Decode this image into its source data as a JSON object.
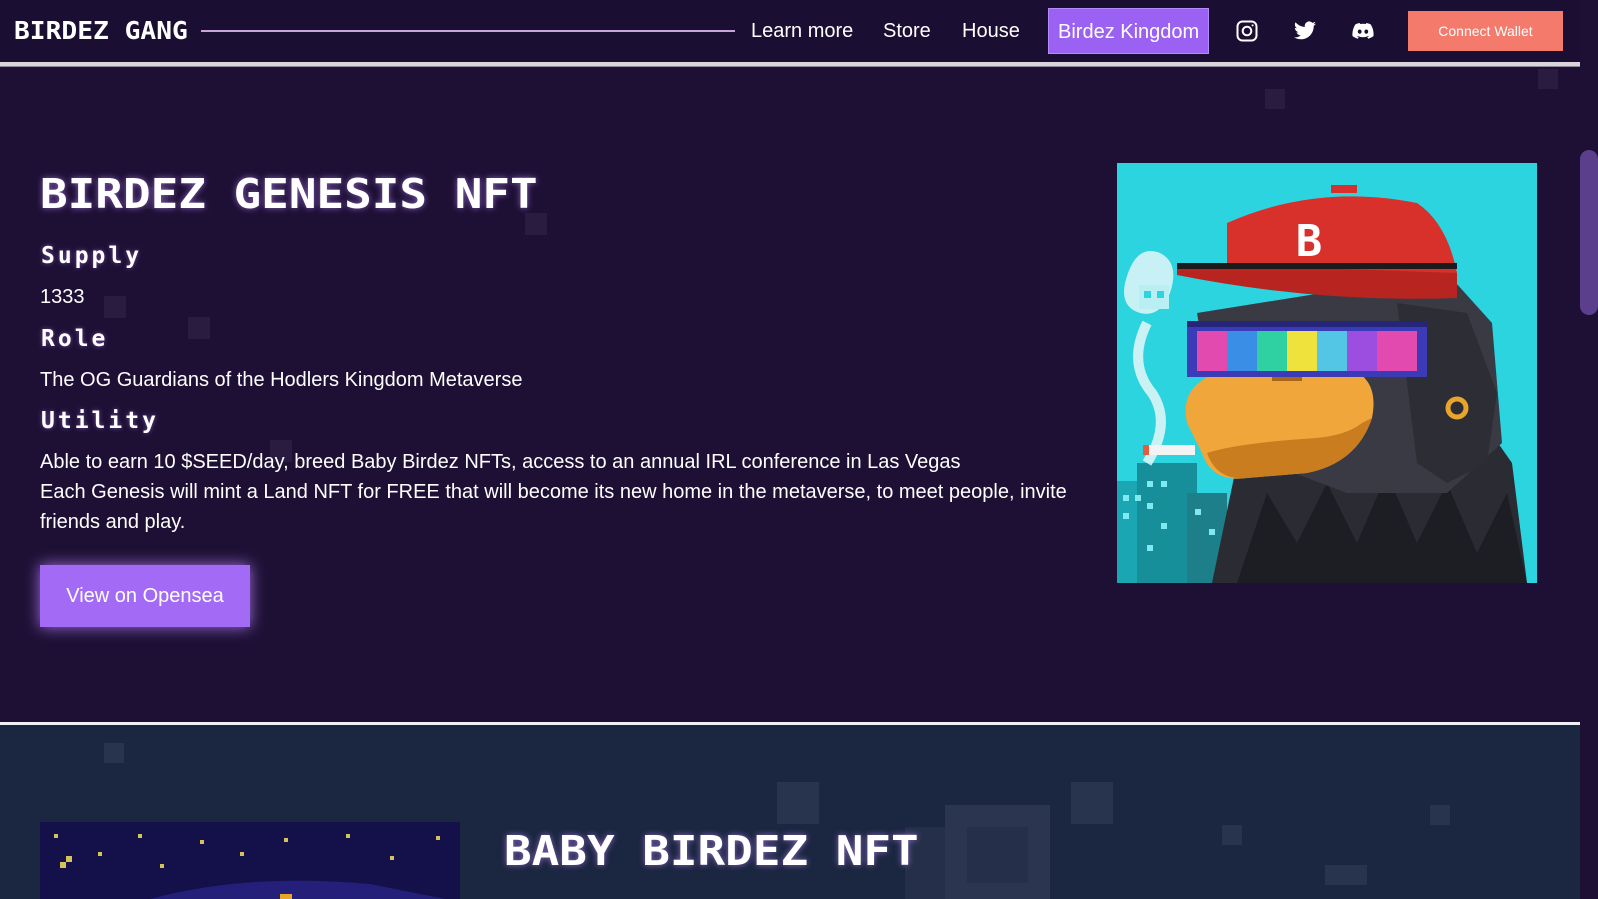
{
  "navbar": {
    "logo": "BIRDEZ GANG",
    "links": {
      "learn_more": "Learn more",
      "store": "Store",
      "house": "House",
      "birdez_kingdom": "Birdez Kingdom"
    },
    "social": [
      "instagram-icon",
      "twitter-icon",
      "discord-icon"
    ],
    "connect_wallet": "Connect Wallet"
  },
  "genesis": {
    "title": "BIRDEZ GENESIS NFT",
    "supply_label": "Supply",
    "supply_value": "1333",
    "role_label": "Role",
    "role_value": "The OG Guardians of the Hodlers Kingdom Metaverse",
    "utility_label": "Utility",
    "utility_line1": "Able to earn 10 $SEED/day, breed Baby Birdez NFTs, access to an annual IRL conference in Las Vegas",
    "utility_line2": "Each Genesis will mint a Land NFT for FREE that will become its new home in the metaverse, to meet people, invite friends and play.",
    "cta": "View on Opensea",
    "image_cap_letter": "B"
  },
  "baby": {
    "title": "BABY BIRDEZ NFT"
  },
  "colors": {
    "page_bg": "#1e1035",
    "nav_bg": "#1b0e33",
    "accent_purple": "#9a61f3",
    "connect_button": "#f47a6b",
    "section2_bg": "#1b2640"
  }
}
